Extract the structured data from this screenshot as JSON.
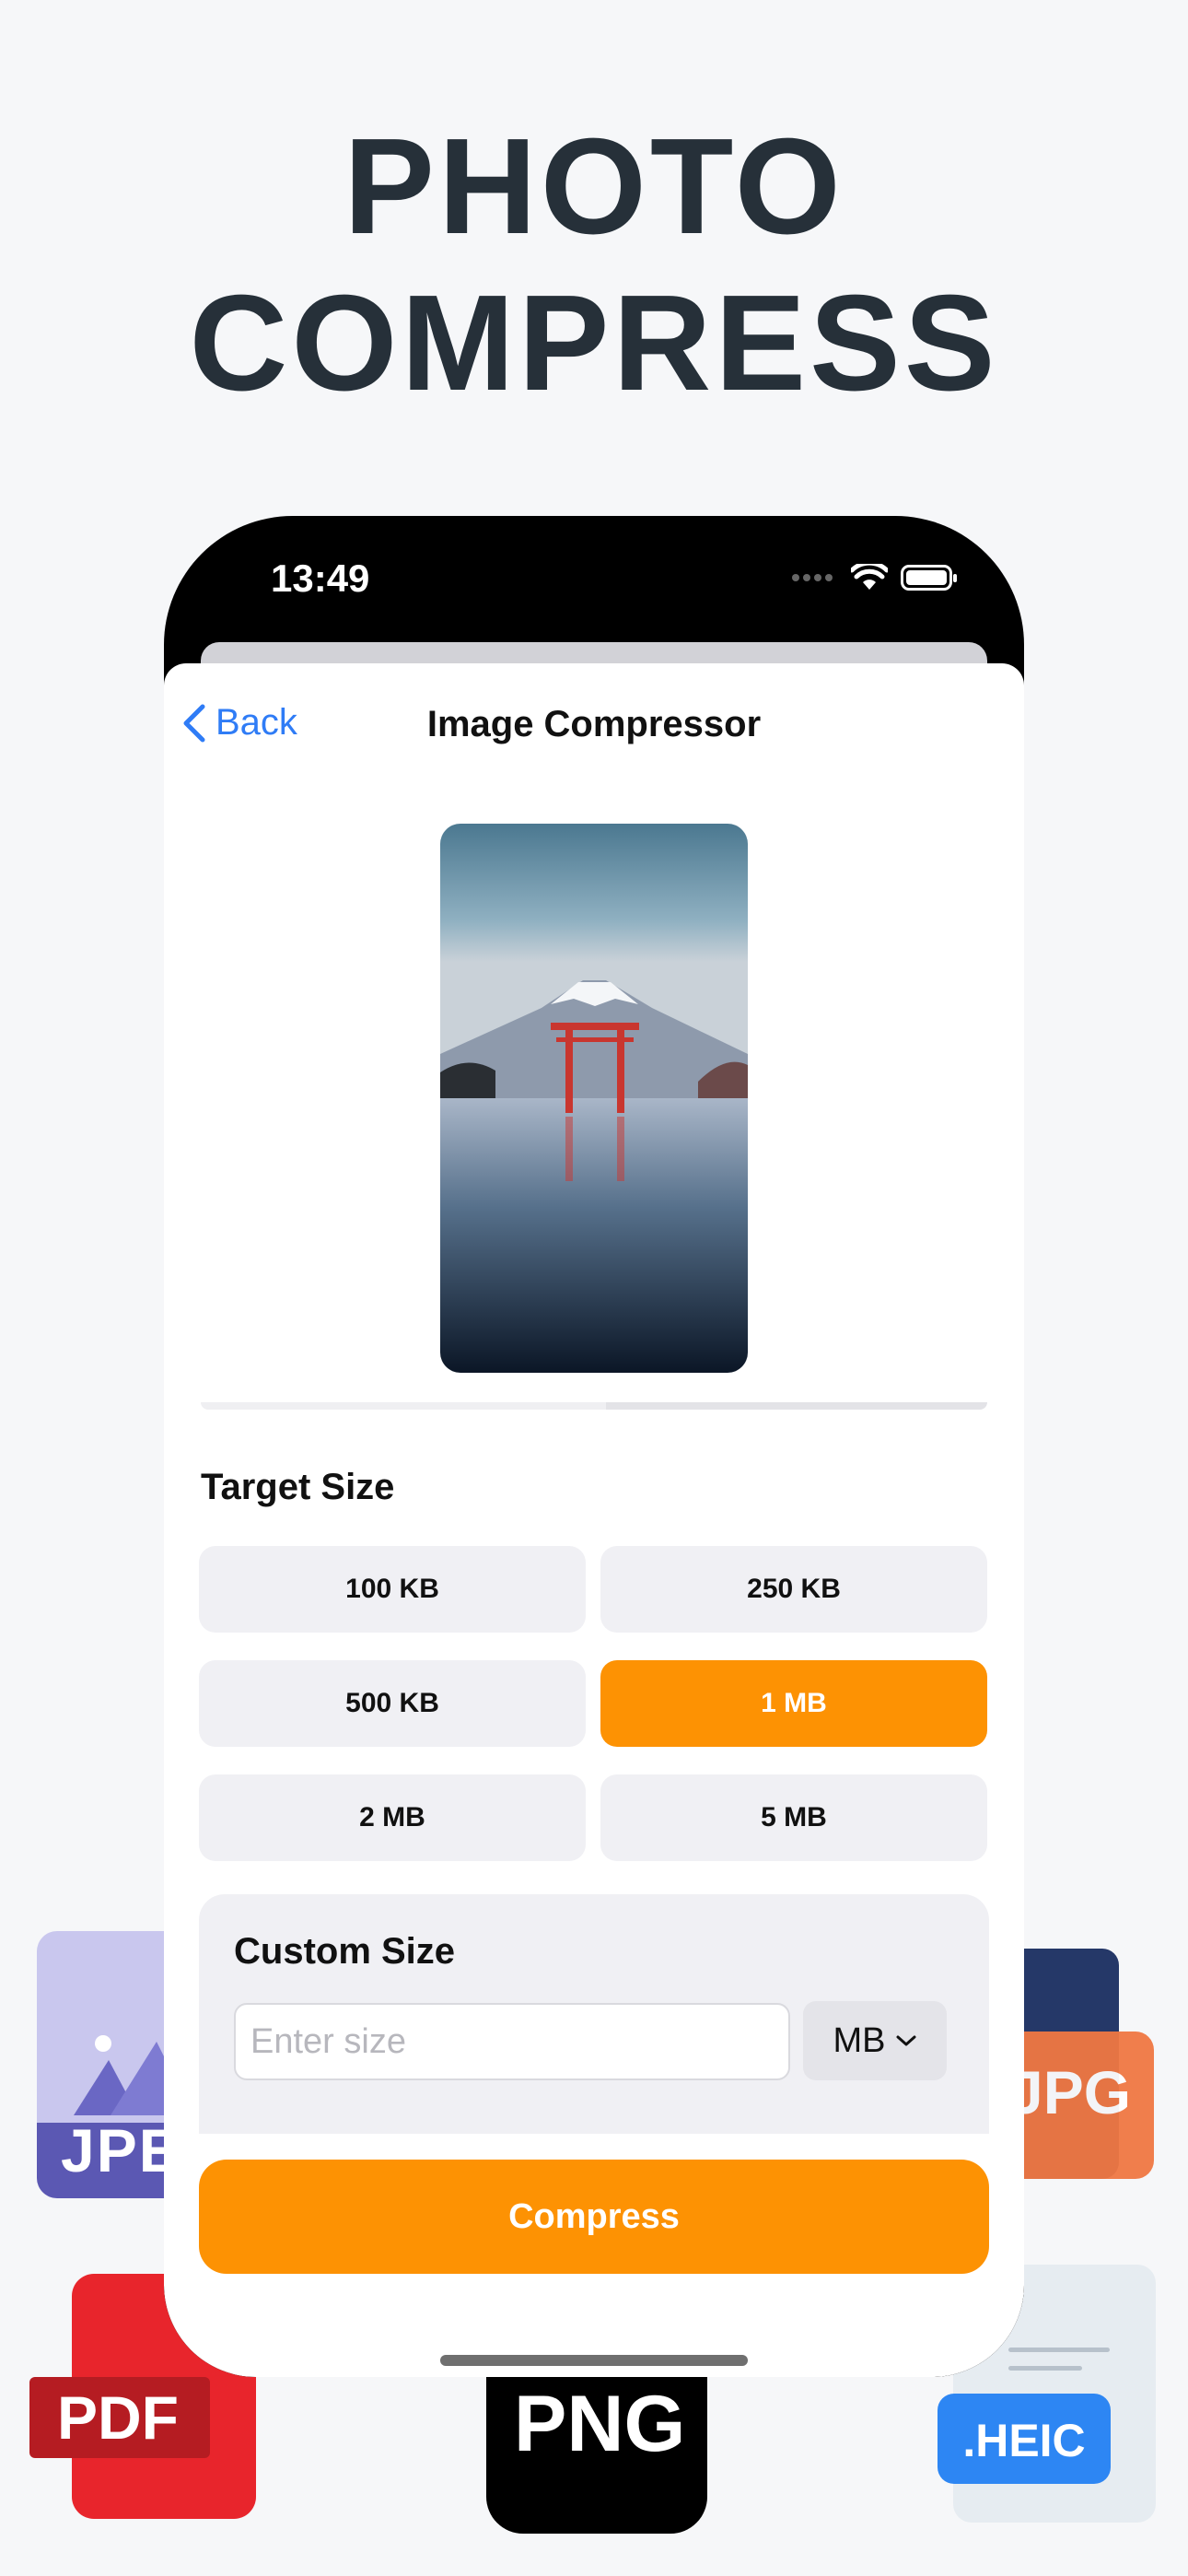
{
  "headline": {
    "line1": "PHOTO",
    "line2": "COMPRESS"
  },
  "status_bar": {
    "time": "13:49"
  },
  "nav": {
    "back_label": "Back",
    "title": "Image Compressor"
  },
  "target_size": {
    "title": "Target Size",
    "options": [
      "100 KB",
      "250 KB",
      "500 KB",
      "1 MB",
      "2 MB",
      "5 MB"
    ],
    "selected": "1 MB"
  },
  "custom_size": {
    "title": "Custom Size",
    "input_placeholder": "Enter size",
    "input_value": "",
    "unit": "MB"
  },
  "compress_label": "Compress",
  "file_badges": {
    "jpeg": "JPE",
    "jpg": "JPG",
    "pdf": "PDF",
    "png": "PNG",
    "heic": ".HEIC"
  },
  "colors": {
    "accent": "#FD9203",
    "link": "#2F7CF6",
    "headline": "#263039"
  }
}
